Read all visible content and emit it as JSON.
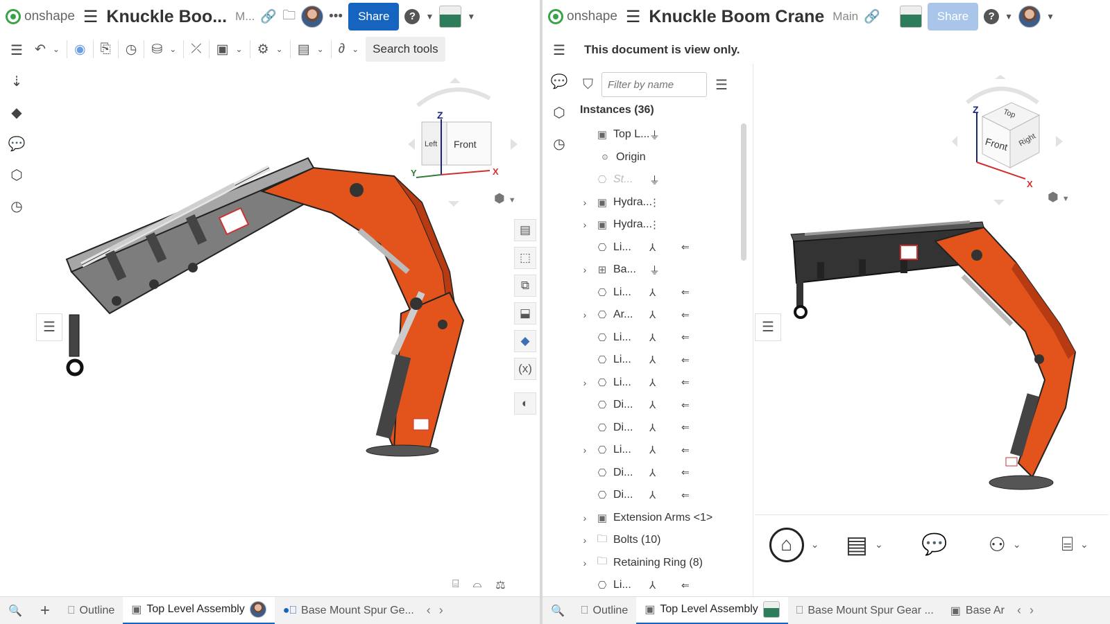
{
  "left": {
    "app_name": "onshape",
    "doc_title": "Knuckle Boo...",
    "workspace": "M...",
    "share_label": "Share",
    "search_tools": "Search tools",
    "tabs": {
      "outline": "Outline",
      "top_level": "Top Level Assembly",
      "base_mount": "Base Mount Spur Ge..."
    },
    "view_cube": {
      "top": "Z",
      "left": "Left",
      "front": "Front",
      "x": "X",
      "y": "Y"
    }
  },
  "right": {
    "app_name": "onshape",
    "doc_title": "Knuckle Boom Crane",
    "workspace": "Main",
    "share_label": "Share",
    "view_only": "This document is view only.",
    "filter_placeholder": "Filter by name",
    "instances_header": "Instances (36)",
    "instances": [
      {
        "name": "Top L...",
        "expand": "",
        "icon": "assembly",
        "mate": "ground"
      },
      {
        "name": "Origin",
        "expand": "",
        "icon": "origin",
        "mate": ""
      },
      {
        "name": "St...",
        "expand": "",
        "icon": "part-dim",
        "mate": "ground"
      },
      {
        "name": "Hydra...",
        "expand": "›",
        "icon": "assembly",
        "mate": "dot"
      },
      {
        "name": "Hydra...",
        "expand": "›",
        "icon": "assembly",
        "mate": "dot"
      },
      {
        "name": "Li...",
        "expand": "",
        "icon": "part",
        "mate": "fastened"
      },
      {
        "name": "Ba...",
        "expand": "›",
        "icon": "assembly-frame",
        "mate": "ground"
      },
      {
        "name": "Li...",
        "expand": "",
        "icon": "part",
        "mate": "fastened"
      },
      {
        "name": "Ar...",
        "expand": "›",
        "icon": "part",
        "mate": "fastened"
      },
      {
        "name": "Li...",
        "expand": "",
        "icon": "part",
        "mate": "fastened"
      },
      {
        "name": "Li...",
        "expand": "",
        "icon": "part",
        "mate": "fastened"
      },
      {
        "name": "Li...",
        "expand": "›",
        "icon": "part",
        "mate": "fastened"
      },
      {
        "name": "Di...",
        "expand": "",
        "icon": "part",
        "mate": "fastened"
      },
      {
        "name": "Di...",
        "expand": "",
        "icon": "part",
        "mate": "fastened"
      },
      {
        "name": "Li...",
        "expand": "›",
        "icon": "part",
        "mate": "fastened"
      },
      {
        "name": "Di...",
        "expand": "",
        "icon": "part",
        "mate": "fastened"
      },
      {
        "name": "Di...",
        "expand": "",
        "icon": "part",
        "mate": "fastened"
      },
      {
        "name": "Extension Arms <1>",
        "expand": "›",
        "icon": "assembly",
        "mate": ""
      },
      {
        "name": "Bolts (10)",
        "expand": "›",
        "icon": "folder",
        "mate": ""
      },
      {
        "name": "Retaining Ring (8)",
        "expand": "›",
        "icon": "folder",
        "mate": ""
      },
      {
        "name": "Li...",
        "expand": "",
        "icon": "part",
        "mate": "fastened"
      }
    ],
    "tabs": {
      "outline": "Outline",
      "top_level": "Top Level Assembly",
      "base_mount": "Base Mount Spur Gear ...",
      "base_arm": "Base Ar"
    },
    "view_cube": {
      "top": "Top",
      "front": "Front",
      "right": "Right",
      "z": "Z",
      "x": "X"
    }
  },
  "colors": {
    "share_blue": "#1565c0",
    "crane_orange": "#e2541c",
    "crane_gray": "#8a8a8a",
    "onshape_green": "#3aa34a"
  }
}
